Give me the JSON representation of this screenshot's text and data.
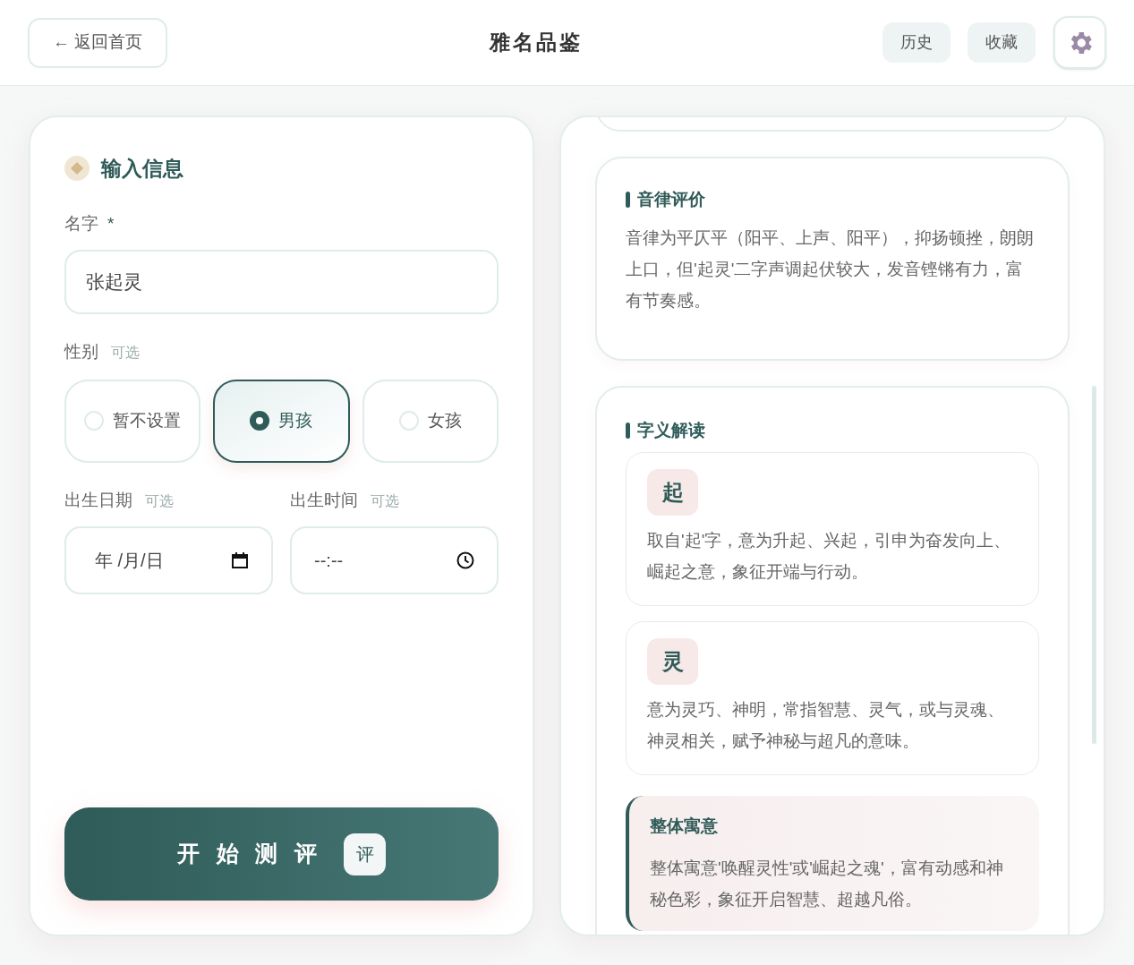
{
  "header": {
    "back": "← 返回首页",
    "title": "雅名品鉴",
    "actions": [
      "历史",
      "收藏"
    ]
  },
  "form": {
    "title": "输入信息",
    "name": {
      "label": "名字",
      "required": "*",
      "value": "张起灵"
    },
    "gender": {
      "label": "性别",
      "hint": "可选",
      "options": [
        {
          "label": "暂不设置",
          "selected": false
        },
        {
          "label": "男孩",
          "selected": true
        },
        {
          "label": "女孩",
          "selected": false
        }
      ]
    },
    "birth_date": {
      "label": "出生日期",
      "hint": "可选",
      "placeholder": "年 /月/日"
    },
    "birth_time": {
      "label": "出生时间",
      "hint": "可选",
      "placeholder": "--:--"
    },
    "submit": {
      "label": "开 始 测 评",
      "badge": "评"
    }
  },
  "results": {
    "sections": [
      {
        "kind": "text",
        "title": "音律评价",
        "body": "音律为平仄平（阳平、上声、阳平），抑扬顿挫，朗朗上口，但'起灵'二字声调起伏较大，发音铿锵有力，富有节奏感。"
      },
      {
        "kind": "chars",
        "title": "字义解读",
        "chars": [
          {
            "char": "起",
            "meaning": "取自'起'字，意为升起、兴起，引申为奋发向上、崛起之意，象征开端与行动。"
          },
          {
            "char": "灵",
            "meaning": "意为灵巧、神明，常指智慧、灵气，或与灵魂、神灵相关，赋予神秘与超凡的意味。"
          }
        ],
        "summary": {
          "title": "整体寓意",
          "body": "整体寓意'唤醒灵性'或'崛起之魂'，富有动感和神秘色彩，象征开启智慧、超越凡俗。"
        }
      }
    ]
  }
}
